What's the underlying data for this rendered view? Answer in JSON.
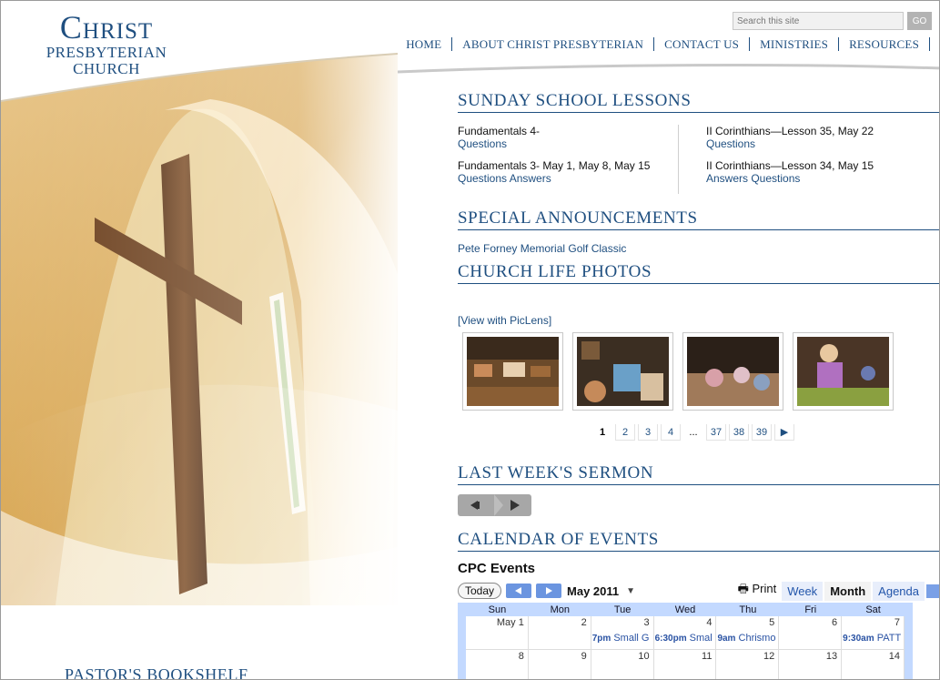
{
  "logo": {
    "line1": "Christ",
    "line2": "PRESBYTERIAN CHURCH"
  },
  "search": {
    "placeholder": "Search this site",
    "button": "GO"
  },
  "nav": [
    "HOME",
    "ABOUT CHRIST PRESBYTERIAN",
    "CONTACT US",
    "MINISTRIES",
    "RESOURCES"
  ],
  "sections": {
    "sunday": "SUNDAY SCHOOL LESSONS",
    "announcements": "SPECIAL ANNOUNCEMENTS",
    "photos": "CHURCH LIFE PHOTOS",
    "sermon": "LAST WEEK'S SERMON",
    "calendar": "CALENDAR OF EVENTS",
    "bookshelf": "PASTOR'S BOOKSHELF"
  },
  "lessons": {
    "left": [
      {
        "title": "Fundamentals 4-",
        "links": "Questions"
      },
      {
        "title": "Fundamentals 3- May 1, May 8, May 15",
        "links": "Questions Answers"
      }
    ],
    "right": [
      {
        "title": "II Corinthians—Lesson 35, May 22",
        "links": "Questions"
      },
      {
        "title": "II Corinthians—Lesson 34, May 15",
        "links": "Answers Questions"
      }
    ]
  },
  "announcement": "Pete Forney Memorial Golf Classic",
  "piclens": "[View with PicLens]",
  "pager": [
    "1",
    "2",
    "3",
    "4",
    "...",
    "37",
    "38",
    "39",
    "▶"
  ],
  "calendar": {
    "title": "CPC Events",
    "today": "Today",
    "month": "May 2011",
    "print": "Print",
    "views": [
      "Week",
      "Month",
      "Agenda"
    ],
    "active_view": "Month",
    "days": [
      "Sun",
      "Mon",
      "Tue",
      "Wed",
      "Thu",
      "Fri",
      "Sat"
    ],
    "week1": [
      {
        "d": "May 1",
        "time": "",
        "ev": ""
      },
      {
        "d": "2",
        "time": "",
        "ev": ""
      },
      {
        "d": "3",
        "time": "7pm",
        "ev": "Small G"
      },
      {
        "d": "4",
        "time": "6:30pm",
        "ev": "Smal"
      },
      {
        "d": "5",
        "time": "9am",
        "ev": "Chrismo"
      },
      {
        "d": "6",
        "time": "",
        "ev": ""
      },
      {
        "d": "7",
        "time": "9:30am",
        "ev": "PATT"
      }
    ],
    "week2": [
      "8",
      "9",
      "10",
      "11",
      "12",
      "13",
      "14"
    ]
  },
  "colors": {
    "accent": "#1f4f80",
    "calendar_blue": "#c3d9ff"
  }
}
